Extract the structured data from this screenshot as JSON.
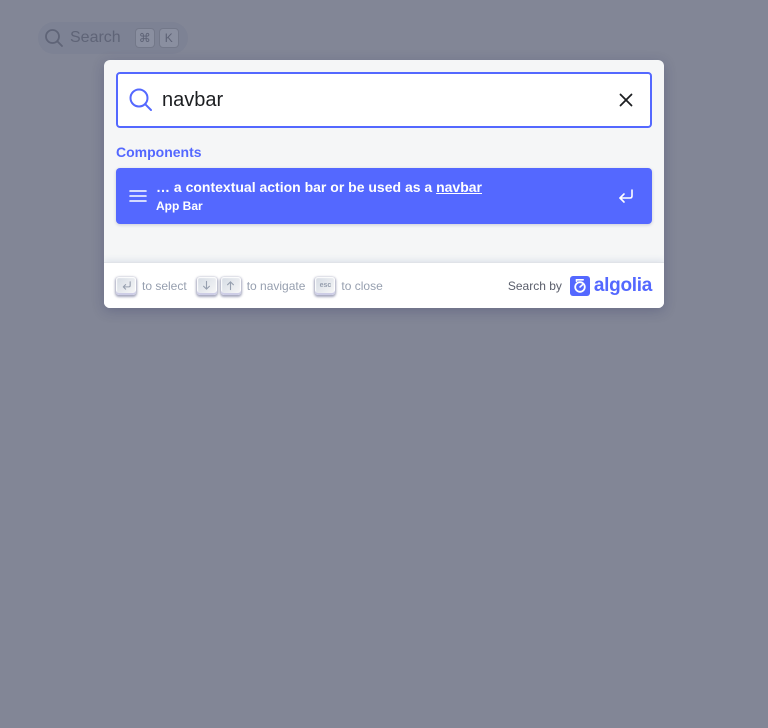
{
  "background": {
    "search_button": {
      "label": "Search",
      "keys": [
        "⌘",
        "K"
      ],
      "icon": "search-icon"
    }
  },
  "modal": {
    "search": {
      "value": "navbar",
      "icon": "search-icon",
      "reset_icon": "close-icon"
    },
    "results": {
      "section_title": "Components",
      "hits": [
        {
          "title_before": "… a contextual action bar or be used as a ",
          "title_highlight": "navbar",
          "path": "App Bar",
          "icon": "lines-icon",
          "action_icon": "enter-icon",
          "selected": true
        }
      ]
    },
    "footer": {
      "commands": [
        {
          "keys": [
            "enter-key"
          ],
          "label": "to select"
        },
        {
          "keys": [
            "arrow-down-key",
            "arrow-up-key"
          ],
          "label": "to navigate"
        },
        {
          "keys": [
            "esc-key"
          ],
          "esc_text": "esc",
          "label": "to close"
        }
      ],
      "search_by": "Search by",
      "brand": "algolia"
    }
  },
  "colors": {
    "accent": "#5468ff",
    "overlay": "#828696",
    "modal_bg": "#f5f6f7",
    "muted_text": "#969faf"
  }
}
